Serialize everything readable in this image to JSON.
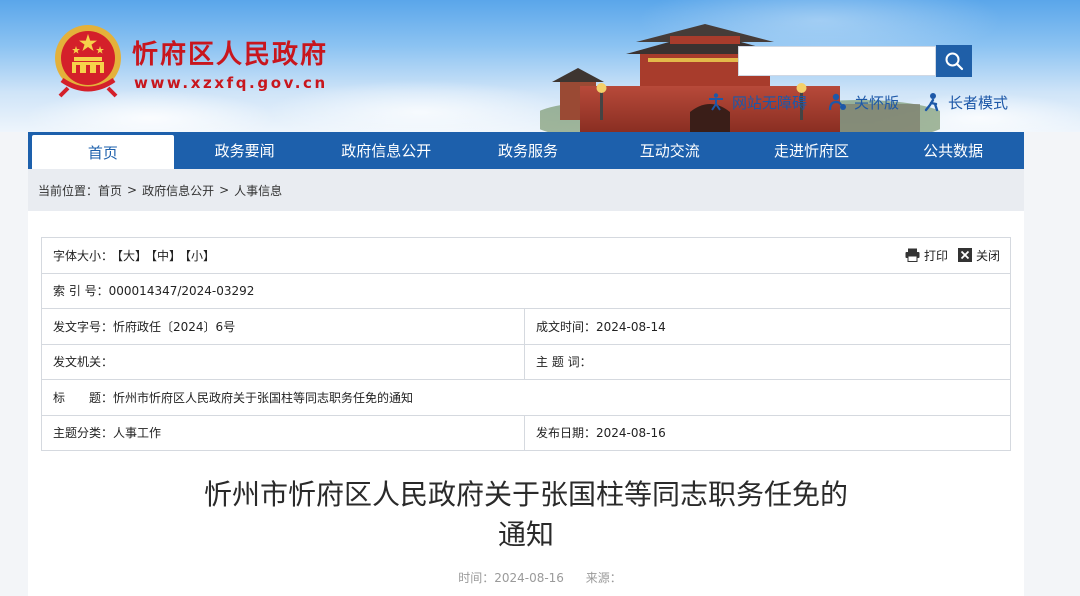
{
  "header": {
    "site_name": "忻府区人民政府",
    "site_url": "www.xzxfq.gov.cn",
    "search": {
      "placeholder": "",
      "value": ""
    },
    "tools": [
      {
        "label": "网站无障碍",
        "icon": "accessibility-icon"
      },
      {
        "label": "关怀版",
        "icon": "care-mode-icon"
      },
      {
        "label": "长者模式",
        "icon": "elder-mode-icon"
      }
    ]
  },
  "nav": {
    "items": [
      {
        "label": "首页",
        "active": true
      },
      {
        "label": "政务要闻"
      },
      {
        "label": "政府信息公开"
      },
      {
        "label": "政务服务"
      },
      {
        "label": "互动交流"
      },
      {
        "label": "走进忻府区"
      },
      {
        "label": "公共数据"
      }
    ]
  },
  "breadcrumb": {
    "prefix": "当前位置：",
    "items": [
      "首页",
      "政府信息公开",
      "人事信息"
    ],
    "separator": ">"
  },
  "info": {
    "font_size_label": "字体大小：",
    "font_large": "【大】",
    "font_medium": "【中】",
    "font_small": "【小】",
    "print_label": "打印",
    "close_label": "关闭",
    "index_label": "索 引 号：",
    "index_value": "000014347/2024-03292",
    "doc_no_label": "发文字号：",
    "doc_no_value": "忻府政任〔2024〕6号",
    "created_label": "成文时间：",
    "created_value": "2024-08-14",
    "issuer_label": "发文机关：",
    "issuer_value": "",
    "keywords_label": "主 题 词：",
    "keywords_value": "",
    "title_label": "标　　题：",
    "title_value": "忻州市忻府区人民政府关于张国柱等同志职务任免的通知",
    "category_label": "主题分类：",
    "category_value": "人事工作",
    "published_label": "发布日期：",
    "published_value": "2024-08-16"
  },
  "document": {
    "title_line1": "忻州市忻府区人民政府关于张国柱等同志职务任免的",
    "title_line2": "通知",
    "time_label": "时间：",
    "time_value": "2024-08-16",
    "source_label": "来源：",
    "source_value": ""
  },
  "colors": {
    "nav_blue": "#1d60ac",
    "brand_red": "#c8161d",
    "link_blue": "#1d58a8"
  }
}
